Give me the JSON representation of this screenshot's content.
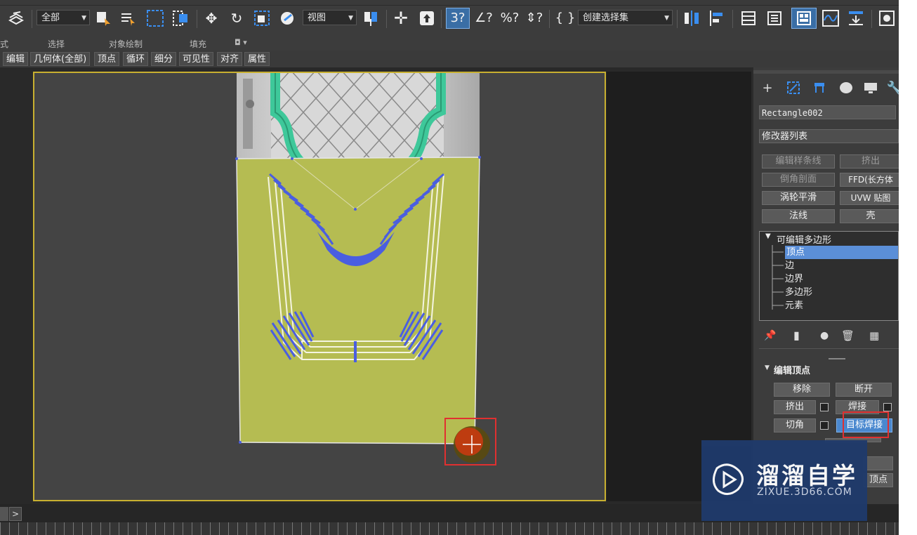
{
  "toolbar": {
    "selection_filter": "全部",
    "reference_coord": "视图",
    "named_selection": "创建选择集",
    "icons": [
      "layers-icon",
      "select-icon",
      "select-by-name-icon",
      "rect-select-icon",
      "window-crossing-icon",
      "move-icon",
      "rotate-icon",
      "scale-icon",
      "link-icon",
      "pivot-icon",
      "snap-3d-icon",
      "angle-snap-icon",
      "percent-snap-icon",
      "spinner-snap-icon",
      "edit-named-sets-icon",
      "mirror-icon",
      "align-icon",
      "layer-manager-icon",
      "scene-explorer-icon",
      "ribbon-icon",
      "curve-editor-icon",
      "schematic-icon",
      "material-editor-icon"
    ],
    "snap_label": "3?",
    "percent_label": "%?",
    "angle_label": "∠?"
  },
  "ribbon": {
    "labels": [
      "式",
      "选择",
      "对象绘制",
      "填充"
    ]
  },
  "subtabs": [
    "编辑",
    "几何体(全部)",
    "顶点",
    "循环",
    "细分",
    "可见性",
    "对齐",
    "属性"
  ],
  "command_panel": {
    "tabs": [
      "create-icon",
      "modify-icon",
      "hierarchy-icon",
      "motion-icon",
      "display-icon",
      "utilities-icon"
    ],
    "object_name": "Rectangle002",
    "modifier_list": "修改器列表",
    "modifier_buttons": [
      "编辑样条线",
      "挤出",
      "倒角剖面",
      "FFD(长方体",
      "涡轮平滑",
      "UVW 贴图",
      "法线",
      "壳"
    ],
    "stack": {
      "root": "可编辑多边形",
      "items": [
        "顶点",
        "边",
        "边界",
        "多边形",
        "元素"
      ],
      "selected": "顶点"
    },
    "edit_vertices": {
      "title": "编辑顶点",
      "buttons": [
        "移除",
        "断开",
        "挤出",
        "焊接",
        "切角",
        "目标焊接"
      ],
      "partial": "顶点"
    }
  },
  "watermark": {
    "title": "溜溜自学",
    "url": "ZIXUE.3D66.COM"
  },
  "colors": {
    "viewport_border": "#c8b030",
    "door_fill": "#b5bc52",
    "green_trim": "#3ec89a",
    "blue_carving": "#4a5ee0",
    "highlight": "#e03030",
    "selected": "#5b8fd8"
  }
}
